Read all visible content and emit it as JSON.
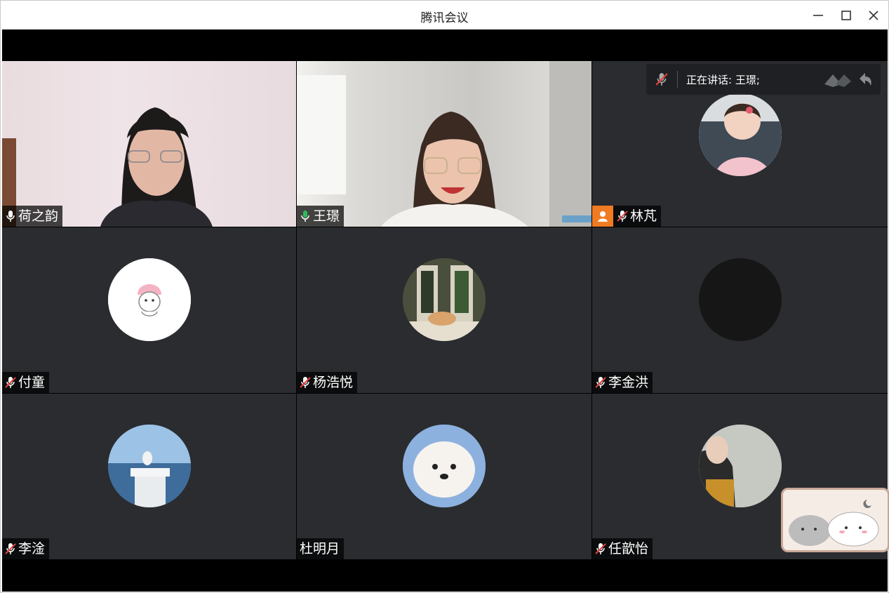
{
  "window": {
    "title": "腾讯会议"
  },
  "speaking_bar": {
    "text": "正在讲话: 王璟;"
  },
  "participants": [
    {
      "name": "荷之韵",
      "mic": "on"
    },
    {
      "name": "王璟",
      "mic": "speaking"
    },
    {
      "name": "林芃",
      "mic": "muted",
      "host": true
    },
    {
      "name": "付童",
      "mic": "muted"
    },
    {
      "name": "杨浩悦",
      "mic": "muted"
    },
    {
      "name": "李金洪",
      "mic": "muted"
    },
    {
      "name": "李淦",
      "mic": "muted"
    },
    {
      "name": "杜明月",
      "mic": "none"
    },
    {
      "name": "任歆怡",
      "mic": "muted"
    }
  ],
  "colors": {
    "tile_bg": "#2a2c2f",
    "speaking_outline": "#2ebc5b",
    "host_badge": "#f07b22"
  }
}
